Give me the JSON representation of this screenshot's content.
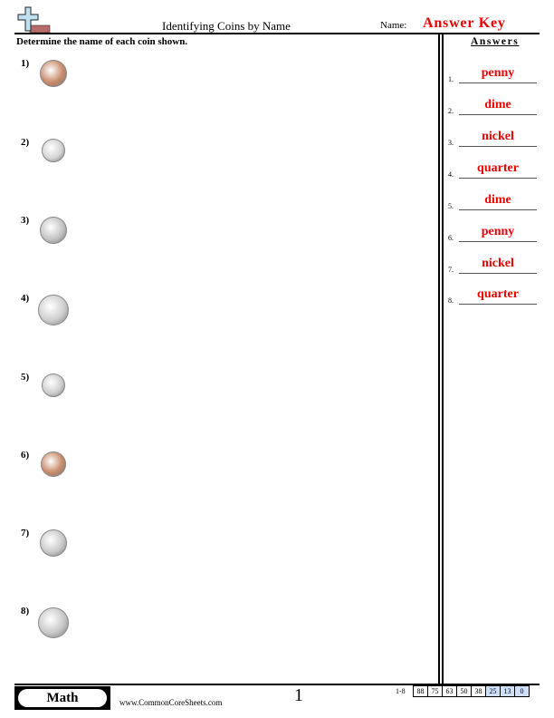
{
  "header": {
    "title": "Identifying Coins by Name",
    "name_label": "Name:",
    "name_value": "Answer Key",
    "instructions": "Determine the name of each coin shown."
  },
  "answers_panel": {
    "heading": "Answers",
    "items": [
      {
        "num": "1.",
        "answer": "penny"
      },
      {
        "num": "2.",
        "answer": "dime"
      },
      {
        "num": "3.",
        "answer": "nickel"
      },
      {
        "num": "4.",
        "answer": "quarter"
      },
      {
        "num": "5.",
        "answer": "dime"
      },
      {
        "num": "6.",
        "answer": "penny"
      },
      {
        "num": "7.",
        "answer": "nickel"
      },
      {
        "num": "8.",
        "answer": "quarter"
      }
    ]
  },
  "questions": [
    {
      "label": "1)",
      "coin": "penny-front-icon",
      "color": "#c88a6a"
    },
    {
      "label": "2)",
      "coin": "dime-front-icon",
      "color": "#d4d4d4"
    },
    {
      "label": "3)",
      "coin": "nickel-front-icon",
      "color": "#c4c4c4"
    },
    {
      "label": "4)",
      "coin": "quarter-back-icon",
      "color": "#cfcfcf"
    },
    {
      "label": "5)",
      "coin": "dime-back-icon",
      "color": "#d0d0d0"
    },
    {
      "label": "6)",
      "coin": "penny-back-icon",
      "color": "#c88a6a"
    },
    {
      "label": "7)",
      "coin": "nickel-back-icon",
      "color": "#cacaca"
    },
    {
      "label": "8)",
      "coin": "quarter-front-icon",
      "color": "#c8c8c8"
    }
  ],
  "footer": {
    "subject": "Math",
    "url": "www.CommonCoreSheets.com",
    "page": "1",
    "range": "1-8",
    "scores": [
      "88",
      "75",
      "63",
      "50",
      "38",
      "25",
      "13",
      "0"
    ],
    "highlight_color": "#cfe0ff"
  },
  "colors": {
    "answer_red": "#ee0000"
  }
}
